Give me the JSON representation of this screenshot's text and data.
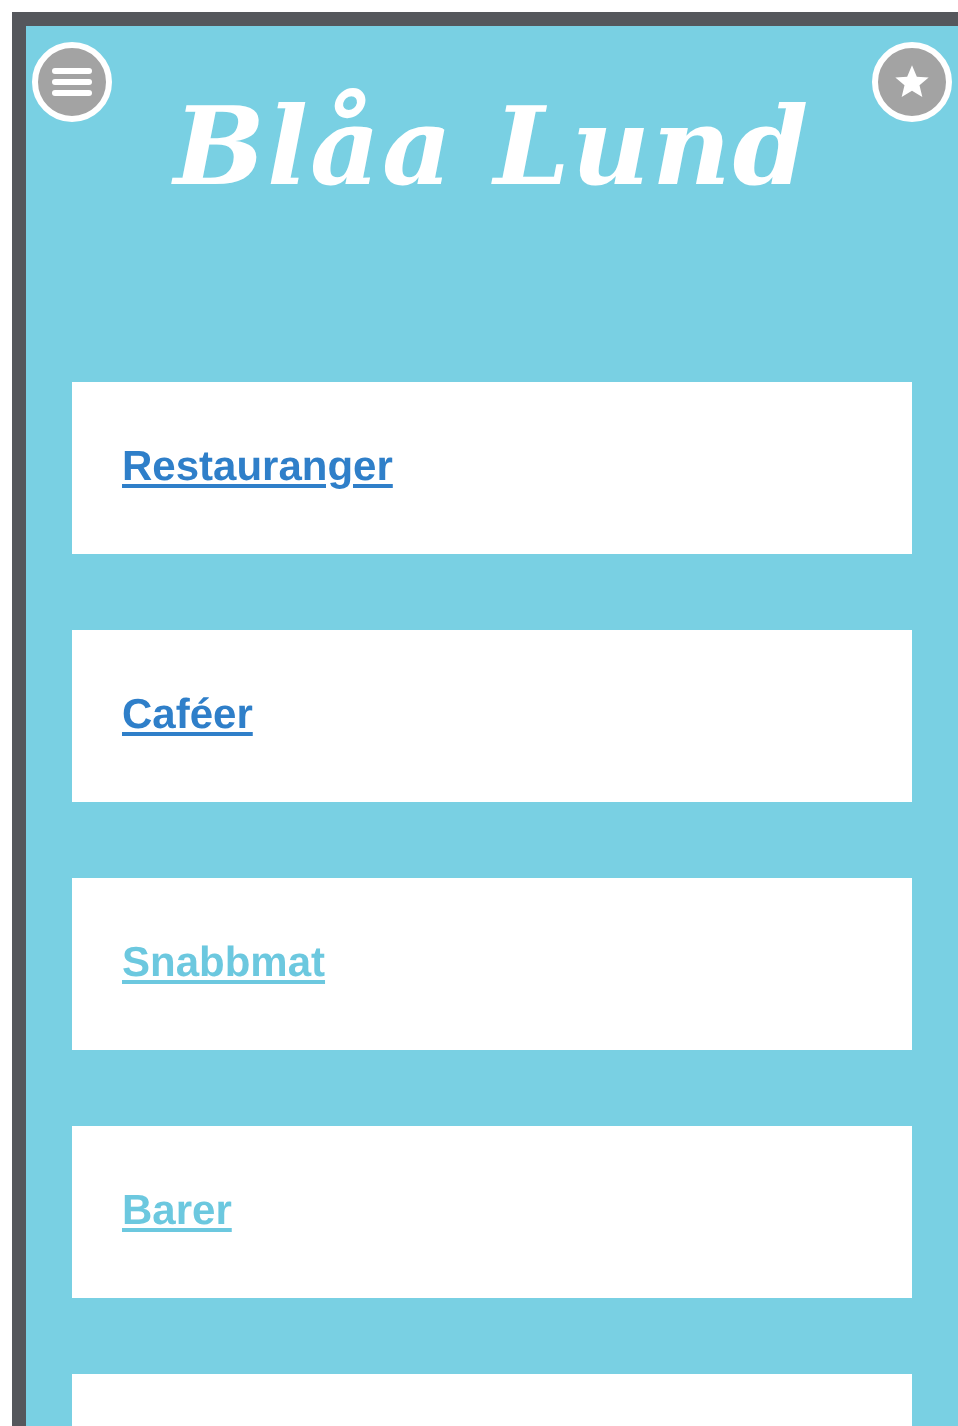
{
  "header": {
    "title": "Blåa Lund"
  },
  "menu_items": [
    {
      "label": "Restauranger",
      "visited": true
    },
    {
      "label": "Caféer",
      "visited": true
    },
    {
      "label": "Snabbmat",
      "visited": false
    },
    {
      "label": "Barer",
      "visited": false
    }
  ]
}
